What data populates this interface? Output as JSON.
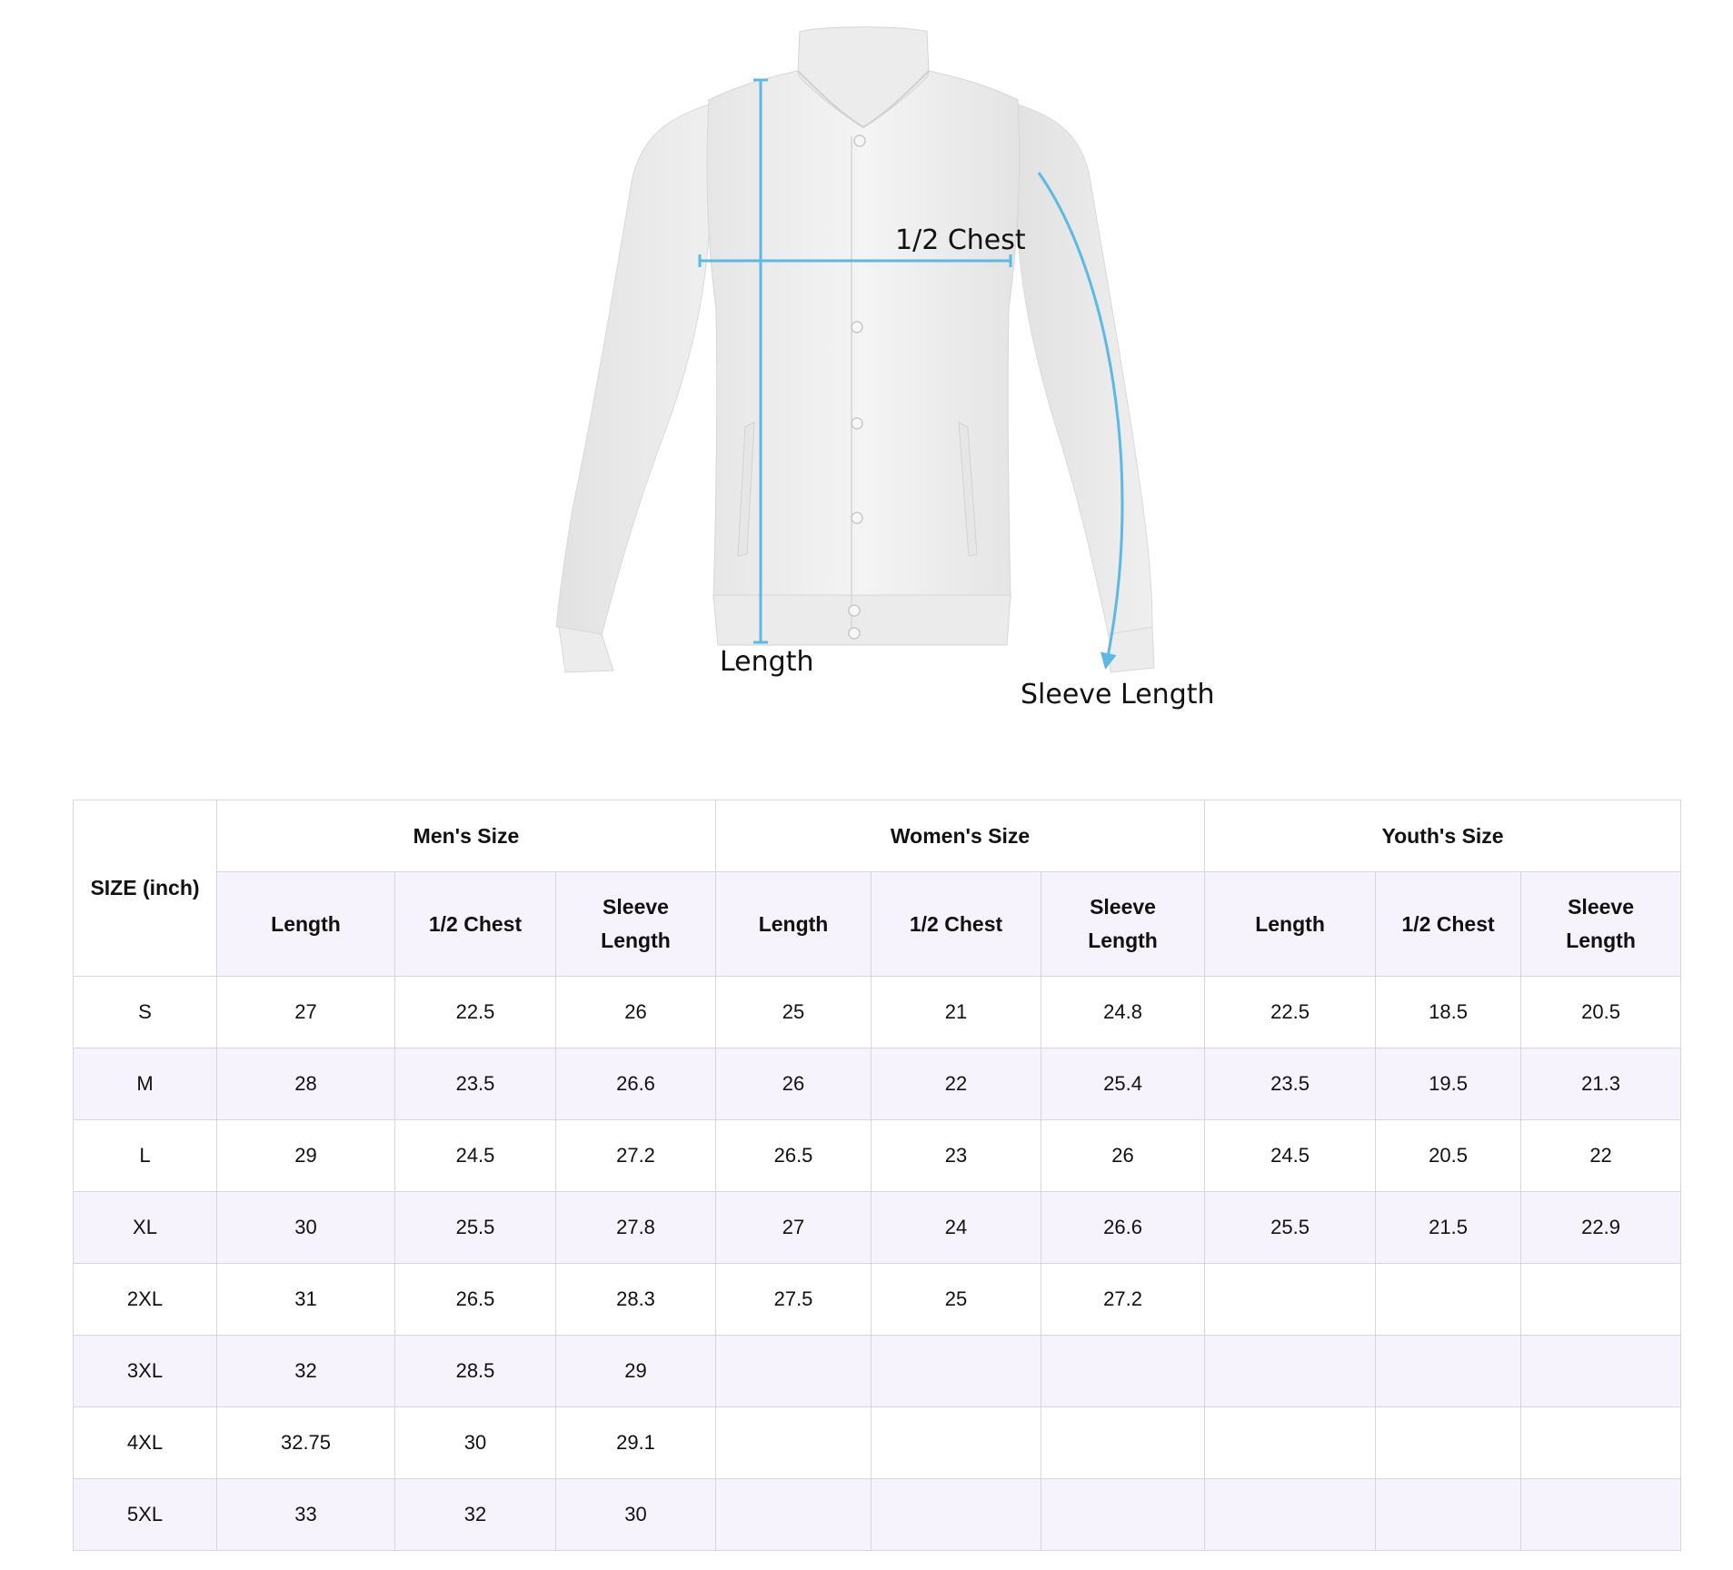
{
  "diagram": {
    "label_length": "Length",
    "label_chest": "1/2 Chest",
    "label_sleeve": "Sleeve Length",
    "jacket_color": "#f1f1f1",
    "measure_color": "#5bb9e3"
  },
  "table": {
    "corner": "SIZE (inch)",
    "groups": [
      "Men's Size",
      "Women's Size",
      "Youth's Size"
    ],
    "sub_headers": {
      "length": "Length",
      "chest": "1/2 Chest",
      "sleeve_top": "Sleeve",
      "sleeve_bottom": "Length"
    },
    "rows": [
      {
        "size": "S",
        "men": [
          "27",
          "22.5",
          "26"
        ],
        "women": [
          "25",
          "21",
          "24.8"
        ],
        "youth": [
          "22.5",
          "18.5",
          "20.5"
        ]
      },
      {
        "size": "M",
        "men": [
          "28",
          "23.5",
          "26.6"
        ],
        "women": [
          "26",
          "22",
          "25.4"
        ],
        "youth": [
          "23.5",
          "19.5",
          "21.3"
        ]
      },
      {
        "size": "L",
        "men": [
          "29",
          "24.5",
          "27.2"
        ],
        "women": [
          "26.5",
          "23",
          "26"
        ],
        "youth": [
          "24.5",
          "20.5",
          "22"
        ]
      },
      {
        "size": "XL",
        "men": [
          "30",
          "25.5",
          "27.8"
        ],
        "women": [
          "27",
          "24",
          "26.6"
        ],
        "youth": [
          "25.5",
          "21.5",
          "22.9"
        ]
      },
      {
        "size": "2XL",
        "men": [
          "31",
          "26.5",
          "28.3"
        ],
        "women": [
          "27.5",
          "25",
          "27.2"
        ],
        "youth": [
          "",
          "",
          ""
        ]
      },
      {
        "size": "3XL",
        "men": [
          "32",
          "28.5",
          "29"
        ],
        "women": [
          "",
          "",
          ""
        ],
        "youth": [
          "",
          "",
          ""
        ]
      },
      {
        "size": "4XL",
        "men": [
          "32.75",
          "30",
          "29.1"
        ],
        "women": [
          "",
          "",
          ""
        ],
        "youth": [
          "",
          "",
          ""
        ]
      },
      {
        "size": "5XL",
        "men": [
          "33",
          "32",
          "30"
        ],
        "women": [
          "",
          "",
          ""
        ],
        "youth": [
          "",
          "",
          ""
        ]
      }
    ]
  }
}
